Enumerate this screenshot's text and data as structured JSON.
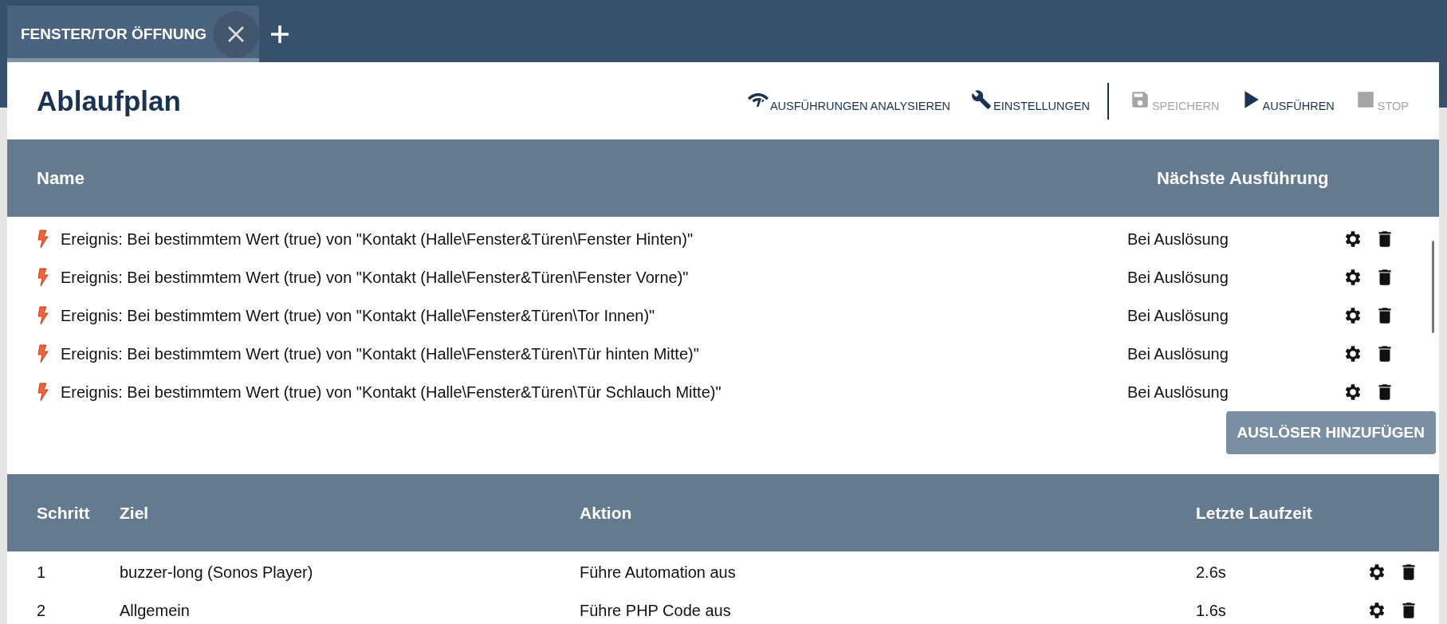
{
  "tabs": [
    {
      "label": "FENSTER/TOR ÖFFNUNG",
      "selected": true
    }
  ],
  "page": {
    "title": "Ablaufplan"
  },
  "toolbar": [
    {
      "label": "AUSFÜHRUNGEN ANALYSIEREN",
      "kind": "gauge",
      "disabled": false
    },
    {
      "label": "EINSTELLUNGEN",
      "kind": "wrench",
      "disabled": false
    },
    {
      "kind": "divider"
    },
    {
      "label": "SPEICHERN",
      "kind": "save",
      "disabled": true
    },
    {
      "label": "AUSFÜHREN",
      "kind": "play",
      "disabled": false
    },
    {
      "label": "STOP",
      "kind": "stop",
      "disabled": true
    }
  ],
  "triggers": {
    "columns": [
      "Name",
      "Nächste Ausführung"
    ],
    "rows": [
      {
        "name": "Ereignis: Bei bestimmtem Wert (true) von \"Kontakt (Halle\\Fenster&Türen\\Fenster Hinten)\"",
        "next": "Bei Auslösung"
      },
      {
        "name": "Ereignis: Bei bestimmtem Wert (true) von \"Kontakt (Halle\\Fenster&Türen\\Fenster Vorne)\"",
        "next": "Bei Auslösung"
      },
      {
        "name": "Ereignis: Bei bestimmtem Wert (true) von \"Kontakt (Halle\\Fenster&Türen\\Tor Innen)\"",
        "next": "Bei Auslösung"
      },
      {
        "name": "Ereignis: Bei bestimmtem Wert (true) von \"Kontakt (Halle\\Fenster&Türen\\Tür hinten Mitte)\"",
        "next": "Bei Auslösung"
      },
      {
        "name": "Ereignis: Bei bestimmtem Wert (true) von \"Kontakt (Halle\\Fenster&Türen\\Tür Schlauch Mitte)\"",
        "next": "Bei Auslösung"
      }
    ],
    "add_button": "AUSLÖSER HINZUFÜGEN"
  },
  "steps": {
    "columns": [
      "Schritt",
      "Ziel",
      "Aktion",
      "Letzte Laufzeit"
    ],
    "rows": [
      {
        "step": "1",
        "target": "buzzer-long (Sonos Player)",
        "action": "Führe Automation aus",
        "runtime": "2.6s"
      },
      {
        "step": "2",
        "target": "Allgemein",
        "action": "Führe PHP Code aus",
        "runtime": "1.6s"
      }
    ]
  }
}
